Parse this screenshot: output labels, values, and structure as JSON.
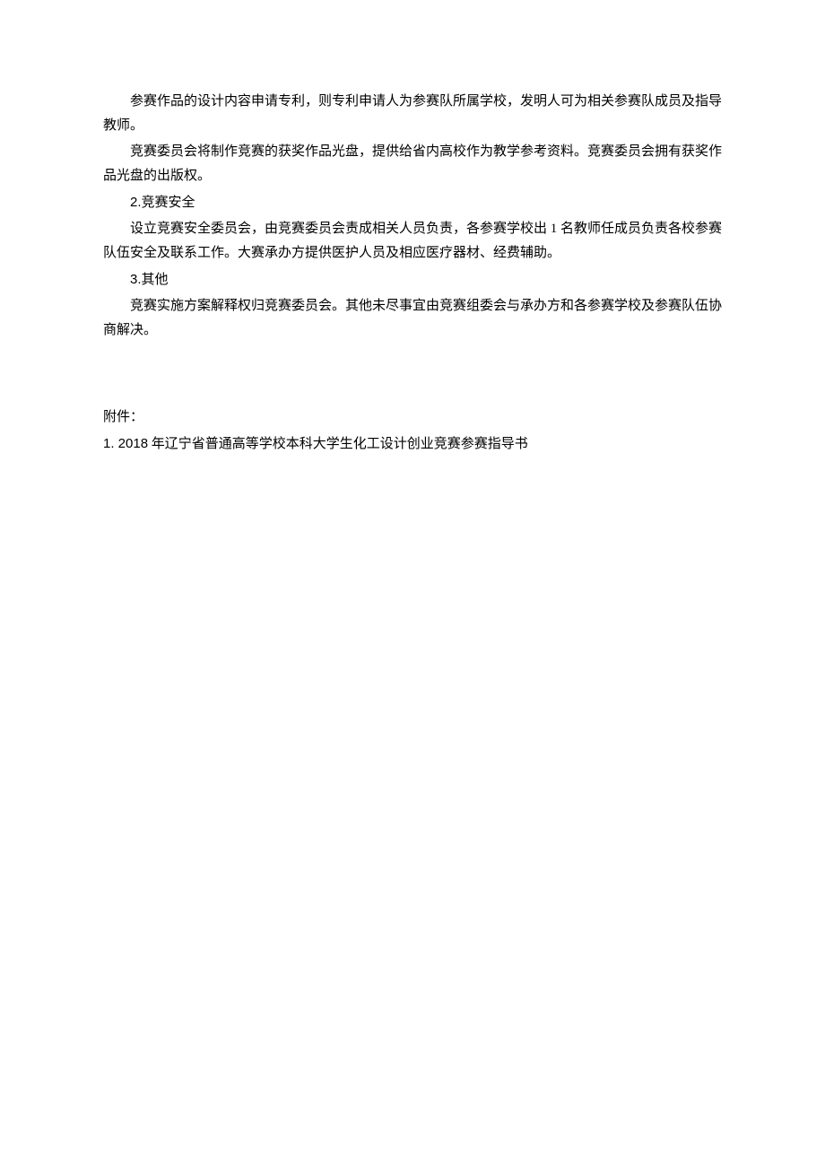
{
  "paragraphs": {
    "p1": "参赛作品的设计内容申请专利，则专利申请人为参赛队所属学校，发明人可为相关参赛队成员及指导教师。",
    "p2": "竞赛委员会将制作竞赛的获奖作品光盘，提供给省内高校作为教学参考资料。竞赛委员会拥有获奖作品光盘的出版权。",
    "s2_prefix": "2.",
    "s2_title": "竞赛安全",
    "p3": "设立竞赛安全委员会，由竞赛委员会责成相关人员负责，各参赛学校出 1 名教师任成员负责各校参赛队伍安全及联系工作。大赛承办方提供医护人员及相应医疗器材、经费辅助。",
    "s3_prefix": "3.",
    "s3_title": "其他",
    "p4": "竞赛实施方案解释权归竞赛委员会。其他未尽事宜由竞赛组委会与承办方和各参赛学校及参赛队伍协商解决。"
  },
  "attachment": {
    "label": "附件：",
    "item1_prefix": "1. 2018",
    "item1_text": " 年辽宁省普通高等学校本科大学生化工设计创业竞赛参赛指导书"
  }
}
